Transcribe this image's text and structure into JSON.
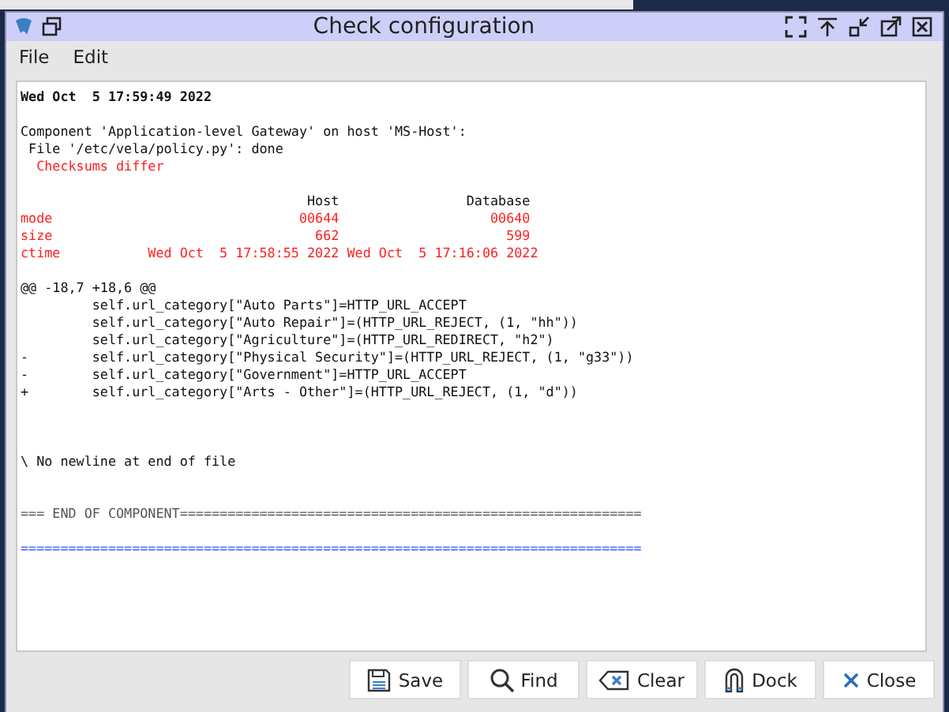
{
  "window": {
    "title": "Check configuration"
  },
  "menu": [
    "File",
    "Edit"
  ],
  "lines": [
    {
      "kind": "bold",
      "text": "Wed Oct  5 17:59:49 2022"
    },
    {
      "kind": "blank"
    },
    {
      "kind": "plain",
      "text": "Component 'Application-level Gateway' on host 'MS-Host':"
    },
    {
      "kind": "plain",
      "text": " File '/etc/vela/policy.py': done"
    },
    {
      "kind": "red",
      "text": "  Checksums differ"
    },
    {
      "kind": "blank"
    },
    {
      "kind": "plain",
      "text": "                                    Host                Database"
    },
    {
      "kind": "red",
      "text": "mode                               00644                   00640"
    },
    {
      "kind": "red",
      "text": "size                                 662                     599"
    },
    {
      "kind": "red",
      "text": "ctime           Wed Oct  5 17:58:55 2022 Wed Oct  5 17:16:06 2022"
    },
    {
      "kind": "blank"
    },
    {
      "kind": "plain",
      "text": "@@ -18,7 +18,6 @@"
    },
    {
      "kind": "plain",
      "text": "         self.url_category[\"Auto Parts\"]=HTTP_URL_ACCEPT"
    },
    {
      "kind": "plain",
      "text": "         self.url_category[\"Auto Repair\"]=(HTTP_URL_REJECT, (1, \"hh\"))"
    },
    {
      "kind": "plain",
      "text": "         self.url_category[\"Agriculture\"]=(HTTP_URL_REDIRECT, \"h2\")"
    },
    {
      "kind": "plain",
      "text": "-        self.url_category[\"Physical Security\"]=(HTTP_URL_REJECT, (1, \"g33\"))"
    },
    {
      "kind": "plain",
      "text": "-        self.url_category[\"Government\"]=HTTP_URL_ACCEPT"
    },
    {
      "kind": "plain",
      "text": "+        self.url_category[\"Arts - Other\"]=(HTTP_URL_REJECT, (1, \"d\"))"
    },
    {
      "kind": "blank"
    },
    {
      "kind": "blank"
    },
    {
      "kind": "blank"
    },
    {
      "kind": "plain",
      "text": "\\ No newline at end of file"
    },
    {
      "kind": "blank"
    },
    {
      "kind": "blank"
    },
    {
      "kind": "rule",
      "text": "=== END OF COMPONENT=========================================================="
    },
    {
      "kind": "blank"
    },
    {
      "kind": "blue",
      "text": "=============================================================================="
    }
  ],
  "buttons": [
    {
      "kind": "save",
      "label": "Save"
    },
    {
      "kind": "find",
      "label": "Find"
    },
    {
      "kind": "clear",
      "label": "Clear"
    },
    {
      "kind": "dock",
      "label": "Dock"
    },
    {
      "kind": "close",
      "label": "Close"
    }
  ]
}
